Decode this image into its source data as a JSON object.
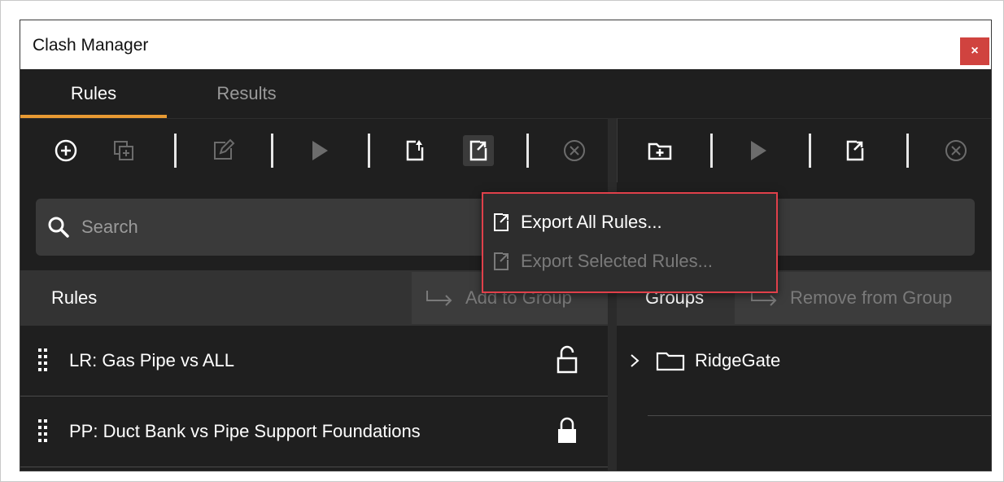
{
  "window": {
    "title": "Clash Manager",
    "close_glyph": "×"
  },
  "tabs": [
    {
      "label": "Rules",
      "active": true
    },
    {
      "label": "Results",
      "active": false
    }
  ],
  "rules_toolbar": {
    "icons": [
      "add-rule-icon",
      "duplicate-rule-icon",
      "edit-rule-icon",
      "run-rule-icon",
      "import-rules-icon",
      "export-rules-icon",
      "delete-rule-icon"
    ]
  },
  "groups_toolbar": {
    "icons": [
      "add-group-icon",
      "run-group-icon",
      "export-group-icon",
      "delete-group-icon"
    ]
  },
  "search": {
    "placeholder": "Search"
  },
  "rules_panel": {
    "header": "Rules",
    "add_to_group": "Add to Group",
    "rules": [
      {
        "name": "LR: Gas Pipe vs ALL",
        "locked": false
      },
      {
        "name": "PP: Duct Bank vs Pipe Support Foundations",
        "locked": true
      }
    ]
  },
  "groups_panel": {
    "header": "Groups",
    "remove_from_group": "Remove from Group",
    "groups": [
      {
        "name": "RidgeGate"
      }
    ]
  },
  "export_menu": {
    "items": [
      {
        "label": "Export All Rules...",
        "enabled": true
      },
      {
        "label": "Export Selected Rules...",
        "enabled": false
      }
    ]
  },
  "colors": {
    "accent_tab_underline": "#e89a33",
    "close_button": "#d0433f",
    "highlight_border": "#e0404a",
    "background": "#1f1f1f"
  }
}
